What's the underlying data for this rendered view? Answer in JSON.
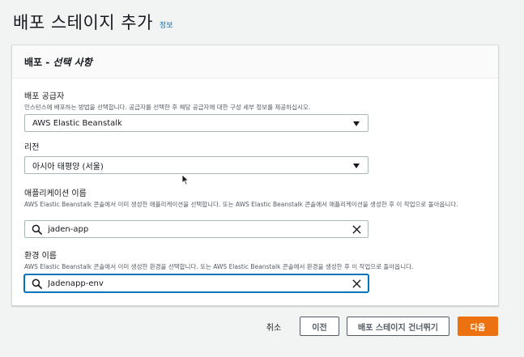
{
  "page": {
    "title": "배포 스테이지 추가",
    "info_link": "정보"
  },
  "panel": {
    "title_prefix": "배포 - ",
    "title_italic": "선택 사항"
  },
  "fields": {
    "provider": {
      "label": "배포 공급자",
      "description": "인스턴스에 배포하는 방법을 선택합니다. 공급자를 선택한 후 해당 공급자에 대한 구성 세부 정보를 제공하십시오.",
      "value": "AWS Elastic Beanstalk"
    },
    "region": {
      "label": "리전",
      "value": "아시아 태평양 (서울)"
    },
    "application": {
      "label": "애플리케이션 이름",
      "description": "AWS Elastic Beanstalk 콘솔에서 이미 생성한 애플리케이션을 선택합니다. 또는 AWS Elastic Beanstalk 콘솔에서 애플리케이션을 생성한 후 이 작업으로 돌아옵니다.",
      "value": "jaden-app"
    },
    "environment": {
      "label": "환경 이름",
      "description": "AWS Elastic Beanstalk 콘솔에서 이미 생성한 환경을 선택합니다. 또는 AWS Elastic Beanstalk 콘솔에서 환경을 생성한 후 이 작업으로 돌아옵니다.",
      "value": "Jadenapp-env"
    }
  },
  "actions": {
    "cancel": "취소",
    "previous": "이전",
    "skip": "배포 스테이지 건너뛰기",
    "next": "다음"
  },
  "icons": {
    "search": "search-icon",
    "clear": "close-icon",
    "caret": "caret-down-icon"
  },
  "colors": {
    "primary": "#ec7211",
    "link": "#0073bb",
    "focus": "#0073bb"
  }
}
